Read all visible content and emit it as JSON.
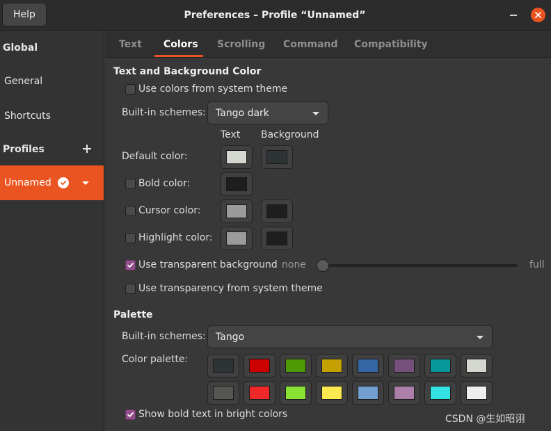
{
  "header": {
    "help_label": "Help",
    "title": "Preferences – Profile “Unnamed”"
  },
  "sidebar": {
    "global_label": "Global",
    "general_label": "General",
    "shortcuts_label": "Shortcuts",
    "profiles_label": "Profiles",
    "profile_name": "Unnamed"
  },
  "tabs": [
    "Text",
    "Colors",
    "Scrolling",
    "Command",
    "Compatibility"
  ],
  "active_tab": "Colors",
  "text_bg": {
    "section_title": "Text and Background Color",
    "use_system_theme_label": "Use colors from system theme",
    "use_system_theme_checked": false,
    "builtin_label": "Built-in schemes:",
    "builtin_value": "Tango dark",
    "col_text": "Text",
    "col_background": "Background",
    "default_label": "Default color:",
    "default_text_color": "#d3d7cf",
    "default_bg_color": "#2e3436",
    "bold_label": "Bold color:",
    "bold_checked": false,
    "bold_color": "#1e1e1e",
    "cursor_label": "Cursor color:",
    "cursor_checked": false,
    "cursor_fg": "#9b9b9b",
    "cursor_bg": "#1e1e1e",
    "highlight_label": "Highlight color:",
    "highlight_checked": false,
    "highlight_fg": "#9b9b9b",
    "highlight_bg": "#1e1e1e",
    "transparent_label": "Use transparent background",
    "transparent_checked": true,
    "slider_min_label": "none",
    "slider_max_label": "full",
    "transparency_value": 0,
    "transparency_system_label": "Use transparency from system theme",
    "transparency_system_checked": false
  },
  "palette": {
    "section_title": "Palette",
    "builtin_label": "Built-in schemes:",
    "builtin_value": "Tango",
    "color_palette_label": "Color palette:",
    "row1": [
      "#2e3436",
      "#cc0000",
      "#4e9a06",
      "#c4a000",
      "#3465a4",
      "#75507b",
      "#06989a",
      "#d3d7cf"
    ],
    "row2": [
      "#555753",
      "#ef2929",
      "#8ae234",
      "#fce94f",
      "#729fcf",
      "#ad7fa8",
      "#34e2e2",
      "#eeeeec"
    ],
    "bold_bright_label": "Show bold text in bright colors",
    "bold_bright_checked": true
  },
  "colors": {
    "accent": "#e95420",
    "checkbox_on": "#924d8b"
  },
  "icons": {
    "close": "close-icon",
    "minimize": "minimize-icon",
    "add_profile": "plus-icon",
    "default_profile": "check-circle-icon",
    "profile_menu": "chevron-down-icon",
    "combo": "chevron-down-icon",
    "checkbox": "check-icon"
  },
  "watermark": "CSDN @生如昭诩"
}
